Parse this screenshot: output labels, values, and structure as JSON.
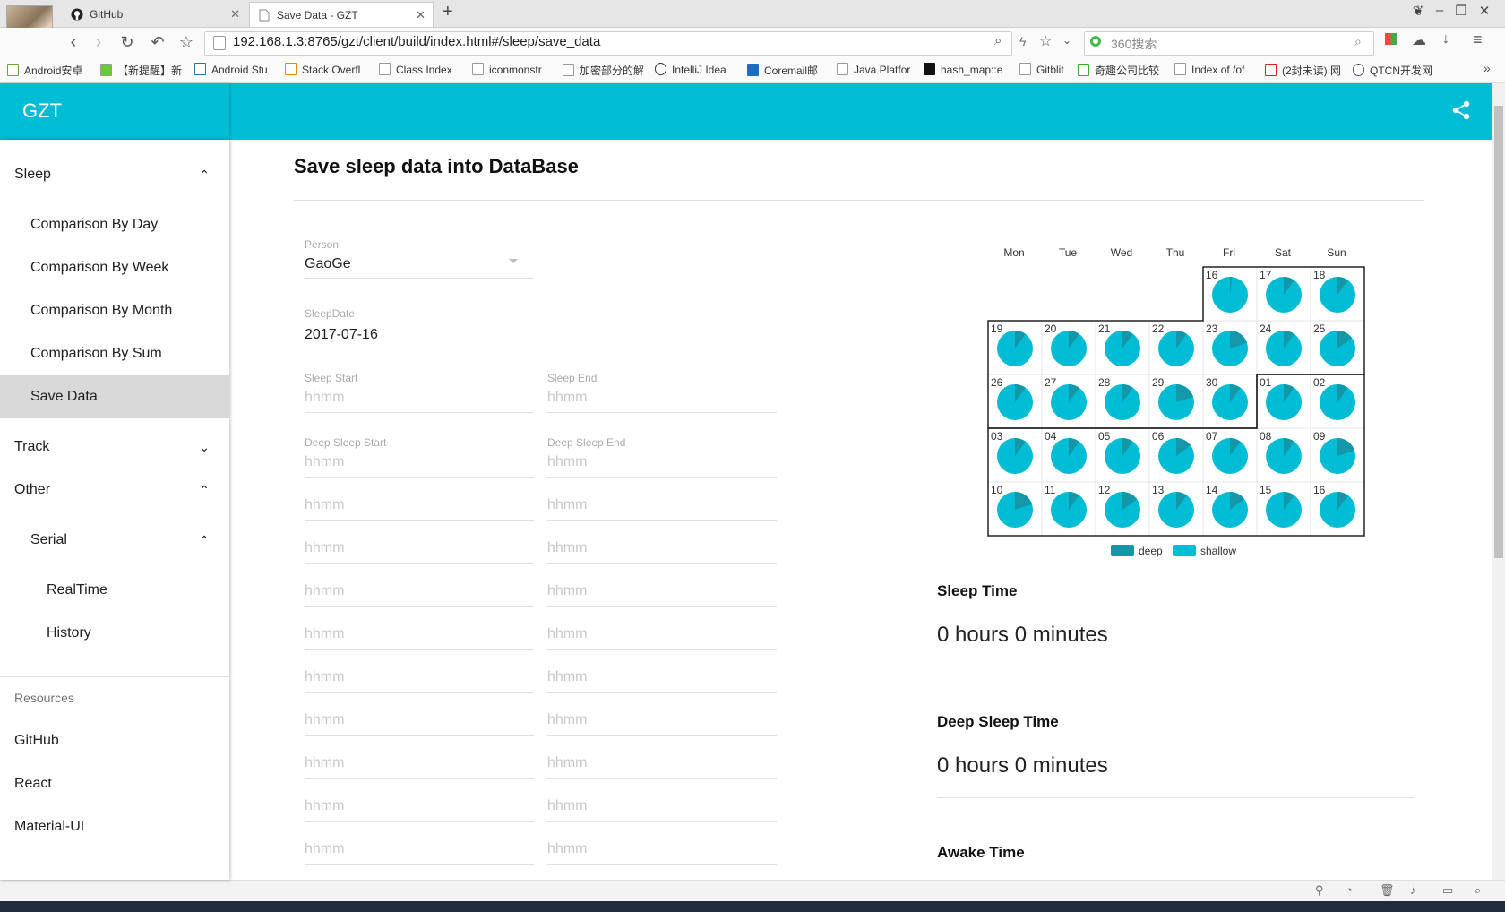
{
  "browser": {
    "tabs": [
      {
        "title": "GitHub",
        "icon": "github-icon"
      },
      {
        "title": "Save Data - GZT",
        "icon": "page-icon"
      }
    ],
    "url": "192.168.1.3:8765/gzt/client/build/index.html#/sleep/save_data",
    "search_placeholder": "360搜索",
    "bookmarks": [
      "Android安卓",
      "【新提醒】新",
      "Android Stu",
      "Stack Overfl",
      "Class Index",
      "iconmonstr",
      "加密部分的解",
      "IntelliJ Idea",
      "Coremail邮",
      "Java Platfor",
      "hash_map::e",
      "Gitblit",
      "奇趣公司比较",
      "Index of /of",
      "(2封未读) 网",
      "QTCN开发网"
    ]
  },
  "app": {
    "brand": "GZT",
    "accent_color": "#00bcd4"
  },
  "sidebar": {
    "sleep": "Sleep",
    "sleep_items": [
      "Comparison By Day",
      "Comparison By Week",
      "Comparison By Month",
      "Comparison By Sum",
      "Save Data"
    ],
    "selected": "Save Data",
    "track": "Track",
    "other": "Other",
    "serial": "Serial",
    "serial_items": [
      "RealTime",
      "History"
    ],
    "resources": "Resources",
    "resource_links": [
      "GitHub",
      "React",
      "Material-UI"
    ]
  },
  "main": {
    "title": "Save sleep data into DataBase",
    "person": {
      "label": "Person",
      "value": "GaoGe"
    },
    "sleep_date": {
      "label": "SleepDate",
      "value": "2017-07-16"
    },
    "sleep_start": {
      "label": "Sleep Start",
      "placeholder": "hhmm"
    },
    "sleep_end": {
      "label": "Sleep End",
      "placeholder": "hhmm"
    },
    "deep_start": {
      "label": "Deep Sleep Start",
      "placeholder": "hhmm"
    },
    "deep_end": {
      "label": "Deep Sleep End",
      "placeholder": "hhmm"
    },
    "extra_placeholder": "hhmm",
    "extra_rows": 9
  },
  "calendar": {
    "weekdays": [
      "Mon",
      "Tue",
      "Wed",
      "Thu",
      "Fri",
      "Sat",
      "Sun"
    ],
    "colors": {
      "deep": "#1497a9",
      "shallow": "#00bcd4"
    },
    "legend": [
      "deep",
      "shallow"
    ],
    "days": [
      {
        "label": "16",
        "deep": 0.02
      },
      {
        "label": "17",
        "deep": 0.1
      },
      {
        "label": "18",
        "deep": 0.1
      },
      {
        "label": "19",
        "deep": 0.1
      },
      {
        "label": "20",
        "deep": 0.1
      },
      {
        "label": "21",
        "deep": 0.1
      },
      {
        "label": "22",
        "deep": 0.1
      },
      {
        "label": "23",
        "deep": 0.2
      },
      {
        "label": "24",
        "deep": 0.1
      },
      {
        "label": "25",
        "deep": 0.15
      },
      {
        "label": "26",
        "deep": 0.1
      },
      {
        "label": "27",
        "deep": 0.1
      },
      {
        "label": "28",
        "deep": 0.1
      },
      {
        "label": "29",
        "deep": 0.2
      },
      {
        "label": "30",
        "deep": 0.1
      },
      {
        "label": "01",
        "deep": 0.1
      },
      {
        "label": "02",
        "deep": 0.1
      },
      {
        "label": "03",
        "deep": 0.1
      },
      {
        "label": "04",
        "deep": 0.1
      },
      {
        "label": "05",
        "deep": 0.1
      },
      {
        "label": "06",
        "deep": 0.15
      },
      {
        "label": "07",
        "deep": 0.1
      },
      {
        "label": "08",
        "deep": 0.1
      },
      {
        "label": "09",
        "deep": 0.2
      },
      {
        "label": "10",
        "deep": 0.2
      },
      {
        "label": "11",
        "deep": 0.1
      },
      {
        "label": "12",
        "deep": 0.15
      },
      {
        "label": "13",
        "deep": 0.1
      },
      {
        "label": "14",
        "deep": 0.15
      },
      {
        "label": "15",
        "deep": 0.1
      },
      {
        "label": "16",
        "deep": 0.1
      }
    ]
  },
  "stats": {
    "sleep_time": {
      "title": "Sleep Time",
      "value": "0 hours 0 minutes"
    },
    "deep_sleep_time": {
      "title": "Deep Sleep Time",
      "value": "0 hours 0 minutes"
    },
    "awake_time": {
      "title": "Awake Time"
    }
  }
}
